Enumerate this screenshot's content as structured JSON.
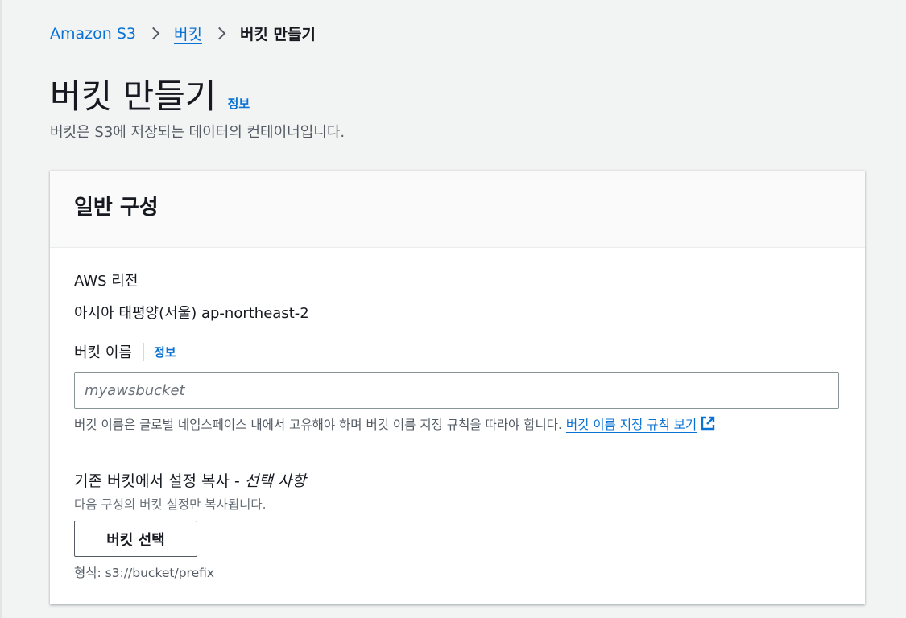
{
  "breadcrumb": {
    "items": [
      "Amazon S3",
      "버킷"
    ],
    "current": "버킷 만들기"
  },
  "header": {
    "title": "버킷 만들기",
    "info_link": "정보",
    "description": "버킷은 S3에 저장되는 데이터의 컨테이너입니다."
  },
  "general_config": {
    "title": "일반 구성",
    "region": {
      "label": "AWS 리전",
      "value": "아시아 태평양(서울) ap-northeast-2"
    },
    "bucket_name": {
      "label": "버킷 이름",
      "info_link": "정보",
      "placeholder": "myawsbucket",
      "value": "",
      "constraint_text": "버킷 이름은 글로벌 네임스페이스 내에서 고유해야 하며 버킷 이름 지정 규칙을 따라야 합니다.",
      "rules_link": "버킷 이름 지정 규칙 보기"
    },
    "copy_settings": {
      "label": "기존 버킷에서 설정 복사 - ",
      "optional": "선택 사항",
      "description": "다음 구성의 버킷 설정만 복사됩니다.",
      "button_label": "버킷 선택",
      "format_hint": "형식: s3://bucket/prefix"
    }
  },
  "icons": {
    "external_link": "external-link-icon",
    "breadcrumb_separator": "chevron-right-icon"
  },
  "colors": {
    "link": "#0972d3",
    "text": "#16191f",
    "secondary_text": "#545b64",
    "background": "#f2f3f3"
  }
}
